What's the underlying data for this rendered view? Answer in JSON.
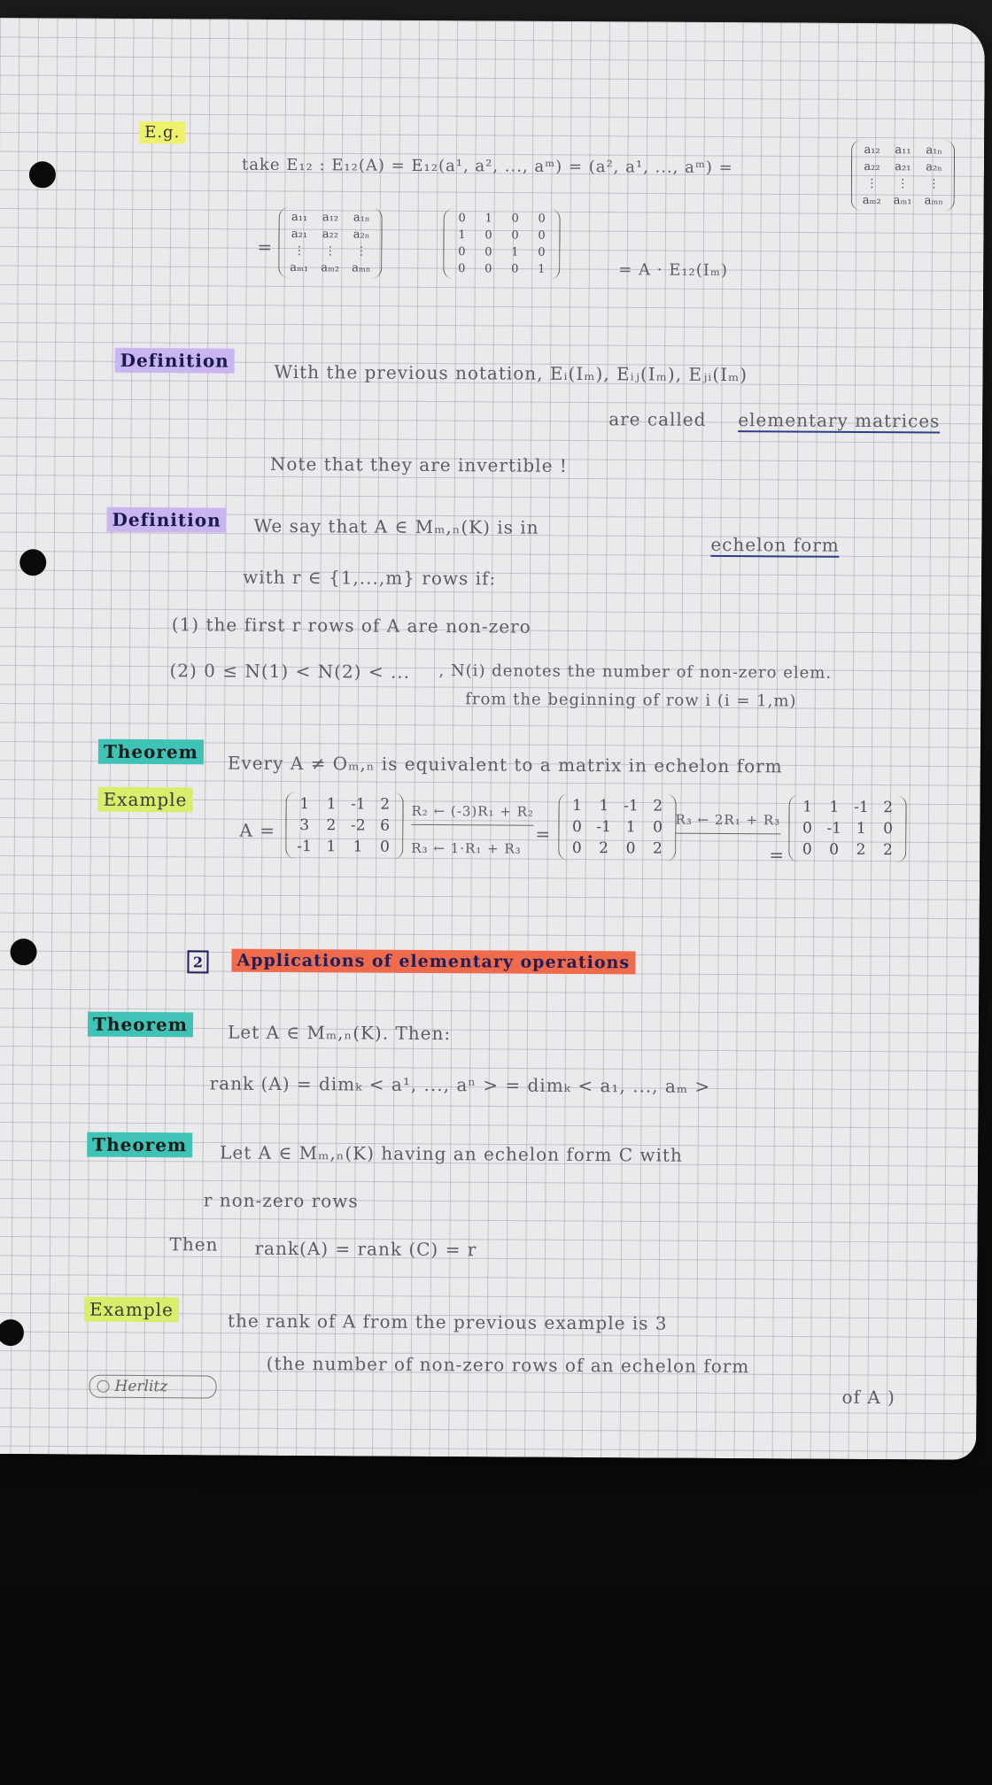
{
  "eg": {
    "label": "E.g.",
    "line1": "take  E₁₂ :  E₁₂(A) = E₁₂(a¹, a², ..., aᵐ) = (a², a¹, ..., aᵐ) =",
    "line2_prefix": "=",
    "line2_suffix": "=  A · E₁₂(Iₘ)"
  },
  "def1": {
    "label": "Definition",
    "line1": "With the previous notation, Eᵢ(Iₘ), Eᵢⱼ(Iₘ), Eⱼᵢ(Iₘ)",
    "line2": "are called",
    "term": "elementary matrices",
    "line3": "Note that they are invertible !"
  },
  "def2": {
    "label": "Definition",
    "line1": "We say that  A ∈ Mₘ,ₙ(K)  is in",
    "term": "echelon form",
    "line2": "with  r ∈ {1,...,m}  rows if:",
    "item1": "(1)  the first  r  rows of A are non-zero",
    "item2a": "(2)  0 ≤ N(1) < N(2) < ...",
    "item2b": ",  N(i) denotes the number of non-zero elem.",
    "item2c": "from the beginning of row  i   (i = 1,m)"
  },
  "thm1": {
    "label": "Theorem",
    "text": "Every  A ≠ Oₘ,ₙ  is equivalent to a matrix in echelon form"
  },
  "ex1": {
    "label": "Example",
    "a_prefix": "A =",
    "op1_top": "R₂ ← (-3)R₁ + R₂",
    "op1_bottom": "R₃ ← 1·R₁ + R₃",
    "eq1": "=",
    "op2_top": "R₃ ← 2R₁ + R₃",
    "eq2": "="
  },
  "section": {
    "number": "2",
    "title": "Applications of elementary operations"
  },
  "thm2": {
    "label": "Theorem",
    "line1": "Let  A ∈ Mₘ,ₙ(K).  Then:",
    "line2": "rank (A) = dimₖ < a¹, ..., aⁿ >  =  dimₖ < a₁, ..., aₘ >"
  },
  "thm3": {
    "label": "Theorem",
    "line1": "Let  A ∈ Mₘ,ₙ(K)  having an echelon form  C  with",
    "line2": "r  non-zero rows",
    "then": "Then",
    "line3": "rank(A) = rank (C) = r"
  },
  "ex2": {
    "label": "Example",
    "line1": "the rank of A from the previous example is 3",
    "line2": "(the number of non-zero rows of an echelon form",
    "line3": "of A )"
  },
  "logo": {
    "text": "Herlitz"
  }
}
